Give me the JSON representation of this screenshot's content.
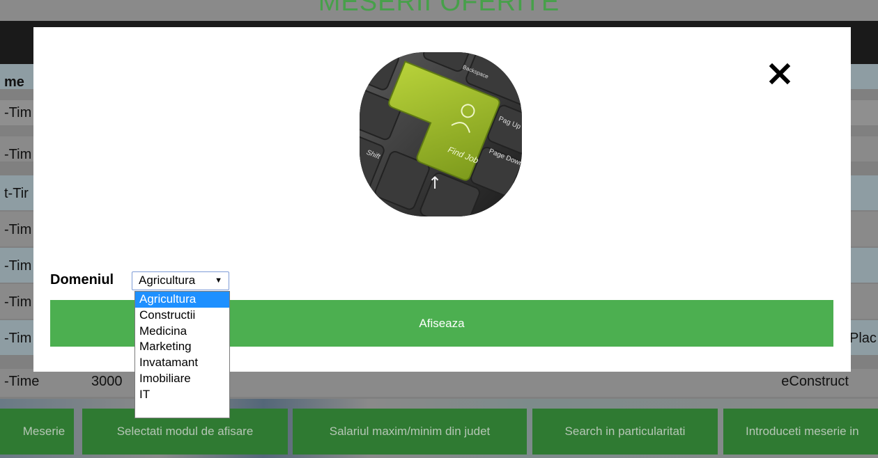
{
  "background": {
    "page_title": "MESERII OFERITE",
    "table_header": "me",
    "rows": [
      {
        "col1": "-Tim",
        "col2": "",
        "col3": ""
      },
      {
        "col1": "-Tim",
        "col2": "",
        "col3": ""
      },
      {
        "col1": "t-Tir",
        "col2": "",
        "col3": ""
      },
      {
        "col1": "-Tim",
        "col2": "",
        "col3": ""
      },
      {
        "col1": "-Tim",
        "col2": "",
        "col3": ""
      },
      {
        "col1": "-Tim",
        "col2": "",
        "col3": ""
      },
      {
        "col1": "-Tim",
        "col2": "",
        "col3": "",
        "col4": "Plac"
      },
      {
        "col1": "-Time",
        "col2": "3000",
        "col3": "eConstruct"
      }
    ],
    "nav_buttons": [
      "Meserie",
      "Selectati modul de afisare",
      "Salariul maxim/minim din judet",
      "Search in particularitati",
      "Introduceti meserie in"
    ]
  },
  "modal": {
    "image_alt": "Find Job keyboard",
    "image_text": {
      "key_label": "Find Job",
      "backspace": "Backspace",
      "shift": "Shift",
      "page_up": "Pag Up",
      "page_down": "Page Down"
    },
    "close_icon": "close-icon",
    "form": {
      "label": "Domeniul",
      "selected_value": "Agricultura",
      "options": [
        "Agricultura",
        "Constructii",
        "Medicina",
        "Marketing",
        "Invatamant",
        "Imobiliare",
        "IT"
      ],
      "submit_label": "Afiseaza"
    }
  },
  "colors": {
    "accent_green": "#4caf50",
    "dark_green": "#2f7a32",
    "title_green": "#47a04a",
    "select_highlight": "#1e90ff",
    "overlay": "#808080"
  }
}
